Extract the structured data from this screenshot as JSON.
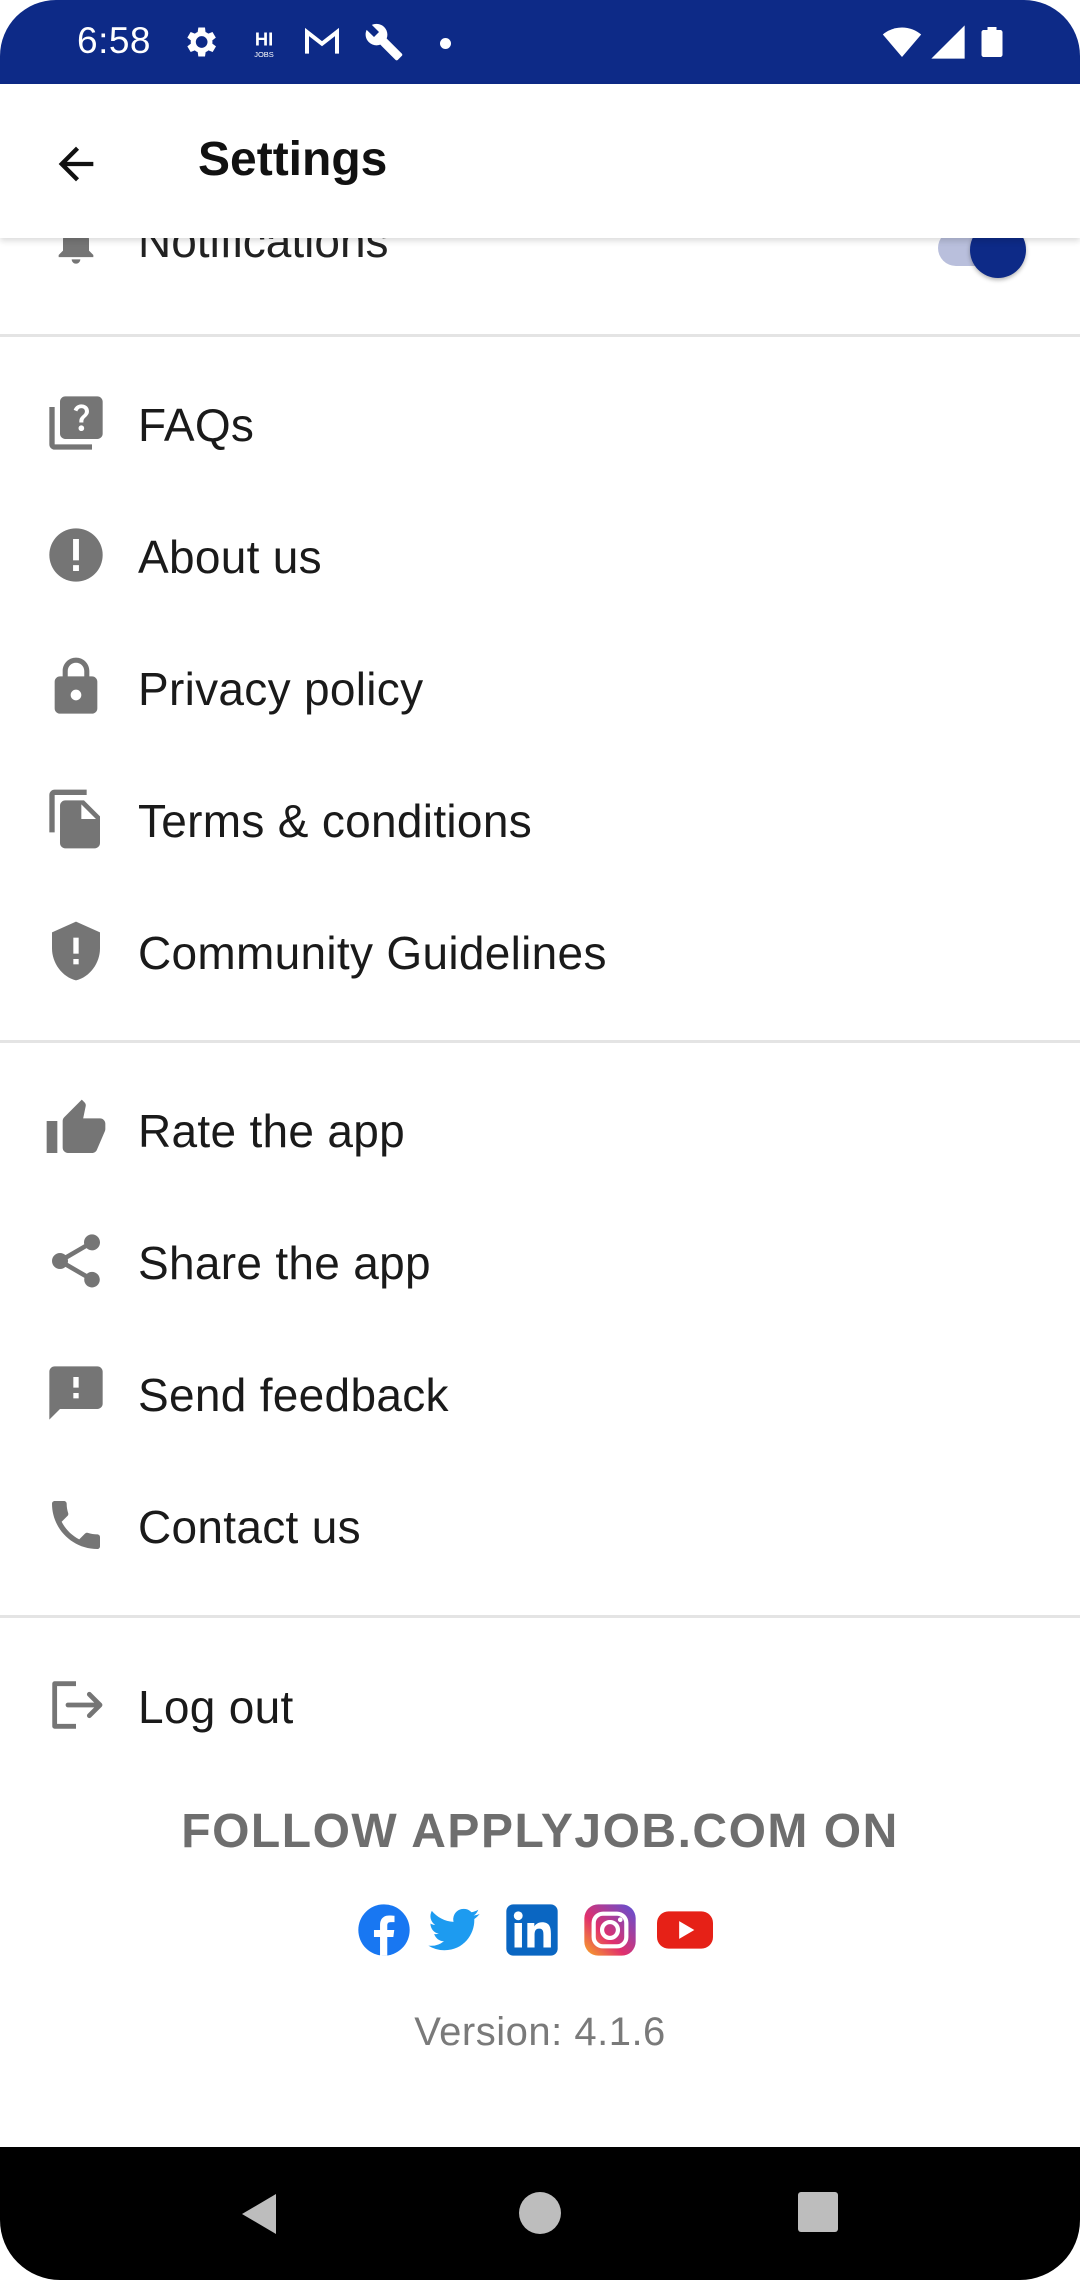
{
  "status_bar": {
    "time": "6:58",
    "left_icons": [
      "gear-icon",
      "hi-jobs-icon",
      "gmail-icon",
      "wrench-icon",
      "dot-icon"
    ],
    "right_icons": [
      "wifi-icon",
      "signal-icon",
      "battery-icon"
    ]
  },
  "header": {
    "title": "Settings",
    "back_icon": "arrow-left-icon"
  },
  "notifications": {
    "label": "Notifications",
    "icon": "bell-icon",
    "toggle_on": true
  },
  "menu_groups": [
    {
      "items": [
        {
          "label": "FAQs",
          "icon": "faq-icon"
        },
        {
          "label": "About us",
          "icon": "info-icon"
        },
        {
          "label": "Privacy policy",
          "icon": "lock-icon"
        },
        {
          "label": "Terms & conditions",
          "icon": "documents-icon"
        },
        {
          "label": "Community Guidelines",
          "icon": "shield-icon"
        }
      ]
    },
    {
      "items": [
        {
          "label": "Rate the app",
          "icon": "thumbs-up-icon"
        },
        {
          "label": "Share the app",
          "icon": "share-icon"
        },
        {
          "label": "Send feedback",
          "icon": "feedback-icon"
        },
        {
          "label": "Contact us",
          "icon": "phone-icon"
        }
      ]
    },
    {
      "items": [
        {
          "label": "Log out",
          "icon": "logout-icon"
        }
      ]
    }
  ],
  "follow": {
    "title": "FOLLOW APPLYJOB.COM ON",
    "socials": [
      "facebook-icon",
      "twitter-icon",
      "linkedin-icon",
      "instagram-icon",
      "youtube-icon"
    ]
  },
  "version": "Version: 4.1.6",
  "colors": {
    "primary": "#0d2a87",
    "icon_gray": "#757575",
    "divider": "#e4e4e4",
    "facebook": "#1877f2",
    "twitter": "#1d9bf0",
    "linkedin": "#0a66c2",
    "youtube": "#e62117"
  },
  "nav_bar": {
    "icons": [
      "nav-back-icon",
      "nav-home-icon",
      "nav-recents-icon"
    ]
  }
}
